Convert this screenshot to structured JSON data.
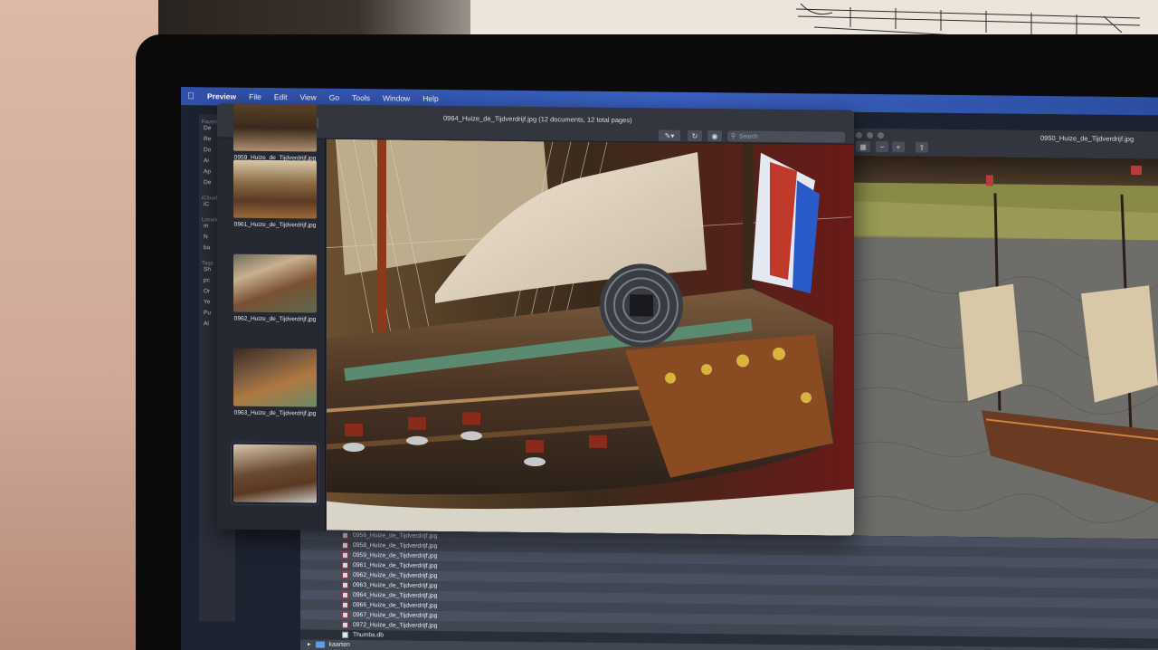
{
  "menubar": {
    "apple": "",
    "items": [
      "Preview",
      "File",
      "Edit",
      "View",
      "Go",
      "Tools",
      "Window",
      "Help"
    ]
  },
  "finder_sidebar": {
    "favorites_header": "Favorie",
    "favorites": [
      "De",
      "Re",
      "Do",
      "Ai",
      "Ap",
      "De"
    ],
    "icloud_header": "iCloud",
    "icloud": [
      "iC"
    ],
    "locations_header": "Location",
    "locations": [
      "m",
      "N",
      "ba"
    ],
    "tags_header": "Tags",
    "tags": [
      "Sh",
      "pc",
      "Or",
      "Ye",
      "Pu",
      "Al"
    ]
  },
  "preview_window": {
    "title": "0964_Huize_de_Tijdverdrijf.jpg (12 documents, 12 total pages)",
    "search_placeholder": "Search",
    "thumbnails": [
      {
        "label": "0959_Huize_de_Tijdverdrijf.jpg"
      },
      {
        "label": "0961_Huize_de_Tijdverdrijf.jpg"
      },
      {
        "label": "0962_Huize_de_Tijdverdrijf.jpg"
      },
      {
        "label": "0963_Huize_de_Tijdverdrijf.jpg"
      },
      {
        "label": ""
      }
    ]
  },
  "preview_window_2": {
    "title": "0950_Huize_de_Tijdverdrijf.jpg"
  },
  "file_list": [
    "0956_Huize_de_Tijdverdrijf.jpg",
    "0958_Huize_de_Tijdverdrijf.jpg",
    "0959_Huize_de_Tijdverdrijf.jpg",
    "0961_Huize_de_Tijdverdrijf.jpg",
    "0962_Huize_de_Tijdverdrijf.jpg",
    "0963_Huize_de_Tijdverdrijf.jpg",
    "0964_Huize_de_Tijdverdrijf.jpg",
    "0966_Huize_de_Tijdverdrijf.jpg",
    "0967_Huize_de_Tijdverdrijf.jpg",
    "0972_Huize_de_Tijdverdrijf.jpg",
    "Thumbs.db"
  ],
  "folder": "kaarten",
  "colors": {
    "menubar": "#3a62c4",
    "close": "#ff5f57",
    "minimize": "#febc2e",
    "zoom": "#28c840"
  }
}
